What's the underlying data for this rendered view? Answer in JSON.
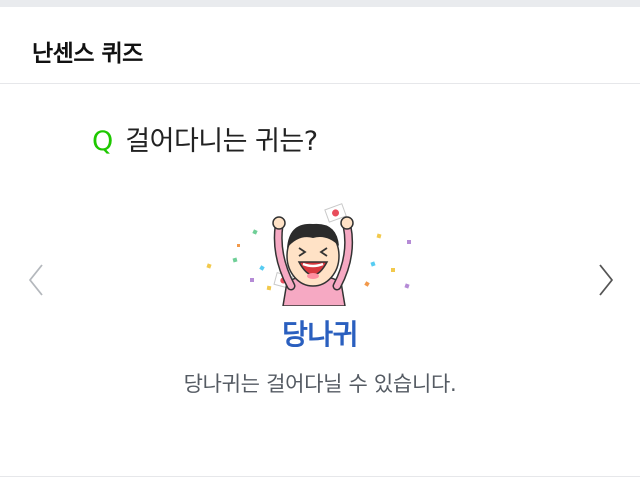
{
  "header": {
    "title": "난센스 퀴즈"
  },
  "question": {
    "mark": "Q",
    "text": "걸어다니는 귀는?"
  },
  "answer": {
    "title": "당나귀",
    "explanation": "당나귀는 걸어다닐 수 있습니다."
  },
  "nav": {
    "prev_icon": "chevron-left-icon",
    "next_icon": "chevron-right-icon"
  },
  "colors": {
    "accent_green": "#1ec800",
    "answer_blue": "#2a5fbf",
    "text_gray": "#555b63"
  }
}
